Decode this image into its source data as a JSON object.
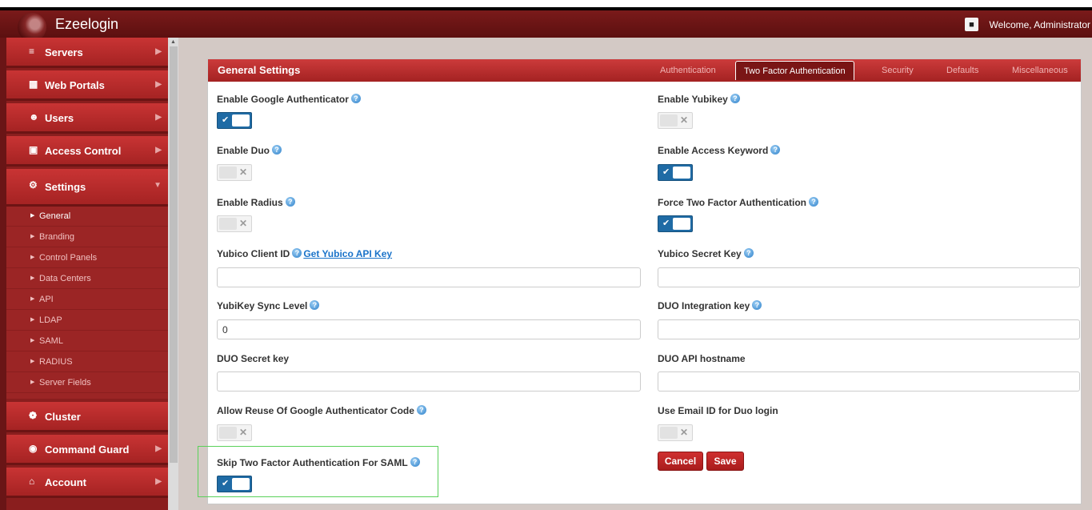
{
  "app": {
    "title": "Ezeelogin",
    "welcome": "Welcome, Administrator"
  },
  "sidebar": {
    "items": [
      {
        "label": "Servers",
        "icon": "list-icon"
      },
      {
        "label": "Web Portals",
        "icon": "grid-icon"
      },
      {
        "label": "Users",
        "icon": "users-icon"
      },
      {
        "label": "Access Control",
        "icon": "lock-icon"
      },
      {
        "label": "Settings",
        "icon": "gears-icon"
      },
      {
        "label": "Cluster",
        "icon": "cluster-icon"
      },
      {
        "label": "Command Guard",
        "icon": "shield-icon"
      },
      {
        "label": "Account",
        "icon": "home-icon"
      }
    ],
    "settings_sub": [
      "General",
      "Branding",
      "Control Panels",
      "Data Centers",
      "API",
      "LDAP",
      "SAML",
      "RADIUS",
      "Server Fields"
    ]
  },
  "panel": {
    "title": "General Settings",
    "tabs": [
      "Authentication",
      "Two Factor Authentication",
      "Security",
      "Defaults",
      "Miscellaneous"
    ],
    "active_tab": "Two Factor Authentication"
  },
  "fields": {
    "google_auth": {
      "label": "Enable Google Authenticator",
      "enabled": true
    },
    "yubikey": {
      "label": "Enable Yubikey",
      "enabled": false
    },
    "duo": {
      "label": "Enable Duo",
      "enabled": false
    },
    "access_keyword": {
      "label": "Enable Access Keyword",
      "enabled": true
    },
    "radius": {
      "label": "Enable Radius",
      "enabled": false
    },
    "force_2fa": {
      "label": "Force Two Factor Authentication",
      "enabled": true
    },
    "yubico_client_id": {
      "label": "Yubico Client ID",
      "link": "Get Yubico API Key",
      "value": ""
    },
    "yubico_secret": {
      "label": "Yubico Secret Key",
      "value": ""
    },
    "yubikey_sync": {
      "label": "YubiKey Sync Level",
      "value": "0"
    },
    "duo_integration": {
      "label": "DUO Integration key",
      "value": ""
    },
    "duo_secret": {
      "label": "DUO Secret key",
      "value": ""
    },
    "duo_api_host": {
      "label": "DUO API hostname",
      "value": ""
    },
    "reuse_google": {
      "label": "Allow Reuse Of Google Authenticator Code",
      "enabled": false
    },
    "duo_email": {
      "label": "Use Email ID for Duo login",
      "enabled": false
    },
    "skip_saml": {
      "label": "Skip Two Factor Authentication For SAML",
      "enabled": true
    }
  },
  "buttons": {
    "cancel": "Cancel",
    "save": "Save"
  },
  "colors": {
    "brand_red": "#b82828",
    "toggle_on": "#1f6ba5",
    "highlight": "#5ad15a"
  }
}
